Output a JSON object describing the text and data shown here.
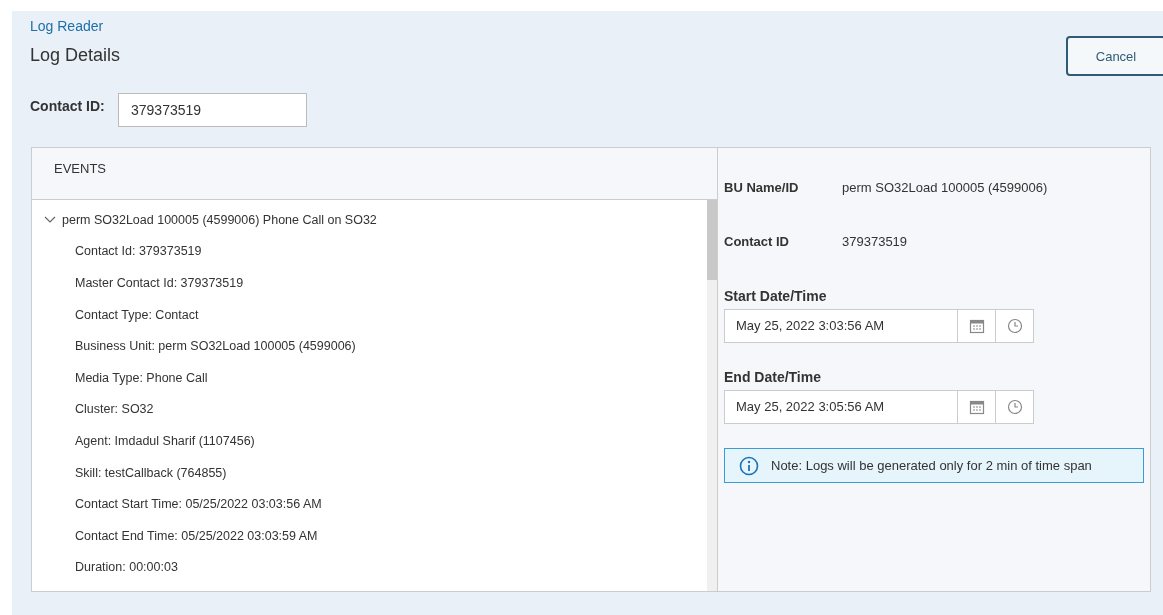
{
  "breadcrumb": "Log Reader",
  "title": "Log Details",
  "cancel_button": "Cancel",
  "contact_id_field": {
    "label": "Contact ID:",
    "value": "379373519"
  },
  "events": {
    "heading": "EVENTS",
    "tree": [
      {
        "label": "perm SO32Load 100005 (4599006) Phone Call on SO32",
        "expanded": true,
        "children": [
          {
            "label": "Contact Id: 379373519"
          },
          {
            "label": "Master Contact Id: 379373519"
          },
          {
            "label": "Contact Type: Contact"
          },
          {
            "label": "Business Unit: perm SO32Load 100005 (4599006)"
          },
          {
            "label": "Media Type: Phone Call"
          },
          {
            "label": "Cluster: SO32"
          },
          {
            "label": "Agent: Imdadul Sharif (1107456)"
          },
          {
            "label": "Skill: testCallback (764855)"
          },
          {
            "label": "Contact Start Time: 05/25/2022 03:03:56 AM"
          },
          {
            "label": "Contact End Time: 05/25/2022 03:03:59 AM"
          },
          {
            "label": "Duration: 00:00:03"
          }
        ]
      }
    ]
  },
  "details": [
    {
      "label": "BU Name/ID",
      "value": "perm SO32Load 100005 (4599006)"
    },
    {
      "label": "Contact ID",
      "value": "379373519"
    }
  ],
  "date_fields": [
    {
      "label": "Start Date/Time",
      "value": "May 25, 2022 3:03:56 AM"
    },
    {
      "label": "End Date/Time",
      "value": "May 25, 2022 3:05:56 AM"
    }
  ],
  "note": "Note: Logs will be generated only for 2 min of time span"
}
